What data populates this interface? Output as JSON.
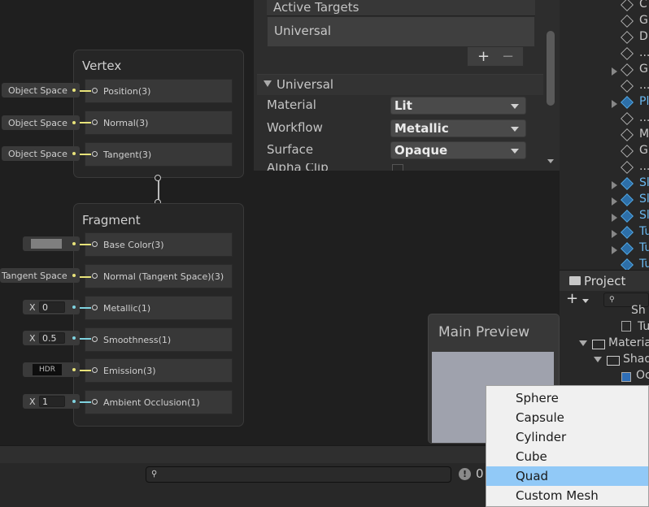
{
  "inspector": {
    "active_targets_label": "Active Targets",
    "target_item": "Universal",
    "add_symbol": "+",
    "remove_symbol": "−",
    "section_title": "Universal",
    "rows": [
      {
        "label": "Material",
        "value": "Lit"
      },
      {
        "label": "Workflow",
        "value": "Metallic"
      },
      {
        "label": "Surface",
        "value": "Opaque"
      },
      {
        "label": "Alpha Clip",
        "value": ""
      }
    ]
  },
  "vertex": {
    "title": "Vertex",
    "ports": [
      {
        "label": "Position(3)",
        "input": "Object Space"
      },
      {
        "label": "Normal(3)",
        "input": "Object Space"
      },
      {
        "label": "Tangent(3)",
        "input": "Object Space"
      }
    ]
  },
  "fragment": {
    "title": "Fragment",
    "ports": [
      {
        "label": "Base Color(3)",
        "input": ""
      },
      {
        "label": "Normal (Tangent Space)(3)",
        "input": "Tangent Space"
      },
      {
        "label": "Metallic(1)",
        "input_prefix": "X",
        "input": "0"
      },
      {
        "label": "Smoothness(1)",
        "input_prefix": "X",
        "input": "0.5"
      },
      {
        "label": "Emission(3)",
        "input": "HDR"
      },
      {
        "label": "Ambient Occlusion(1)",
        "input_prefix": "X",
        "input": "1"
      }
    ]
  },
  "preview": {
    "title": "Main Preview"
  },
  "context_menu": {
    "items": [
      "Sphere",
      "Capsule",
      "Cylinder",
      "Cube",
      "Quad",
      "Custom Mesh"
    ],
    "selected": "Quad"
  },
  "hierarchy": {
    "rows": [
      {
        "text": "C",
        "blue": false
      },
      {
        "text": "G",
        "blue": false
      },
      {
        "text": "D",
        "blue": false
      },
      {
        "text": "...",
        "blue": false
      },
      {
        "text": "G",
        "blue": false
      },
      {
        "text": "...",
        "blue": false
      },
      {
        "text": "Pl",
        "blue": true
      },
      {
        "text": "...",
        "blue": false
      },
      {
        "text": "M",
        "blue": false
      },
      {
        "text": "G",
        "blue": false
      },
      {
        "text": "...",
        "blue": false
      },
      {
        "text": "Sl",
        "blue": true
      },
      {
        "text": "Sl",
        "blue": true
      },
      {
        "text": "Sl",
        "blue": true
      },
      {
        "text": "Tu",
        "blue": true
      },
      {
        "text": "Tu",
        "blue": true
      },
      {
        "text": "Tu",
        "blue": true
      }
    ]
  },
  "project": {
    "tab_label": "Project",
    "rows": [
      {
        "text": "Sh"
      },
      {
        "text": "Tu"
      },
      {
        "text": "Materia"
      },
      {
        "text": "Shad"
      },
      {
        "text": "Oc"
      }
    ]
  },
  "bottom": {
    "count": "0"
  },
  "colors": {
    "accent_yellow": "#e8e37a",
    "accent_cyan": "#7fd3e0",
    "menu_selection": "#91c9f7"
  }
}
